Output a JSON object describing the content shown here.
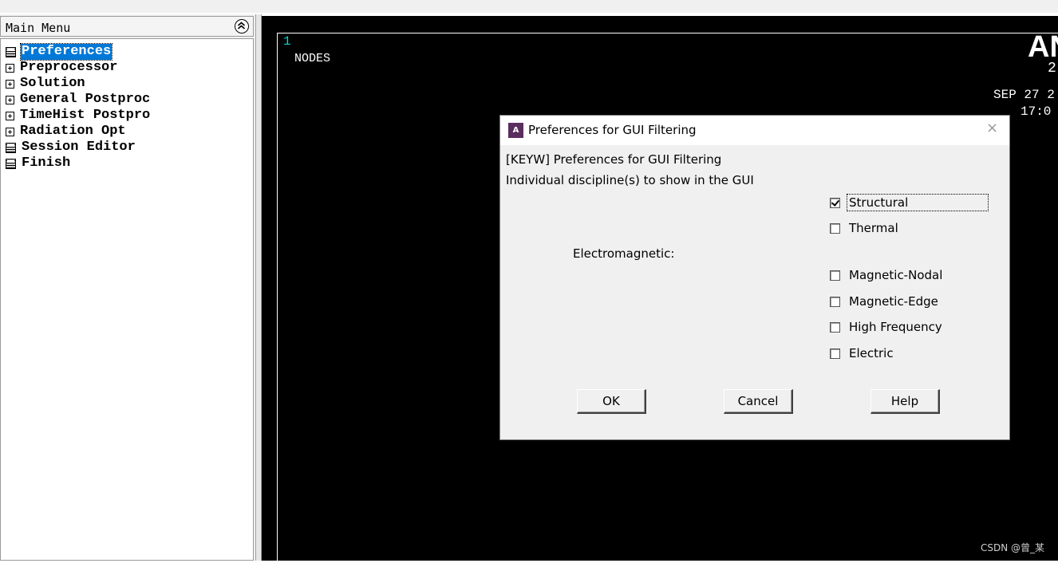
{
  "main_menu": {
    "title": "Main Menu",
    "items": [
      {
        "label": "Preferences",
        "icon": "calculator-icon",
        "selected": true
      },
      {
        "label": "Preprocessor",
        "icon": "expand-plus-icon"
      },
      {
        "label": "Solution",
        "icon": "expand-plus-icon"
      },
      {
        "label": "General Postproc",
        "icon": "expand-plus-icon"
      },
      {
        "label": "TimeHist Postpro",
        "icon": "expand-plus-icon"
      },
      {
        "label": "Radiation Opt",
        "icon": "expand-plus-icon"
      },
      {
        "label": "Session Editor",
        "icon": "calculator-icon"
      },
      {
        "label": "Finish",
        "icon": "calculator-icon"
      }
    ]
  },
  "graphics": {
    "window_number": "1",
    "label": "NODES",
    "logo_fragment": "AN",
    "version_fragment": "2(",
    "date_fragment": "SEP 27 2",
    "time_fragment": "17:0",
    "watermark": "CSDN @曾_某"
  },
  "dialog": {
    "title": "Preferences for GUI Filtering",
    "heading": "[KEYW] Preferences for GUI Filtering",
    "subheading": "Individual discipline(s) to show in the GUI",
    "group_label": "Electromagnetic:",
    "options": [
      {
        "label": "Structural",
        "checked": true
      },
      {
        "label": "Thermal",
        "checked": false
      },
      {
        "label": "Magnetic-Nodal",
        "checked": false
      },
      {
        "label": "Magnetic-Edge",
        "checked": false
      },
      {
        "label": "High Frequency",
        "checked": false
      },
      {
        "label": "Electric",
        "checked": false
      }
    ],
    "buttons": {
      "ok": "OK",
      "cancel": "Cancel",
      "help": "Help"
    }
  },
  "colors": {
    "selection": "#0078d7",
    "graphics_background": "#000000",
    "window_number": "#00d5d5",
    "app_icon": "#5a2e5e"
  }
}
